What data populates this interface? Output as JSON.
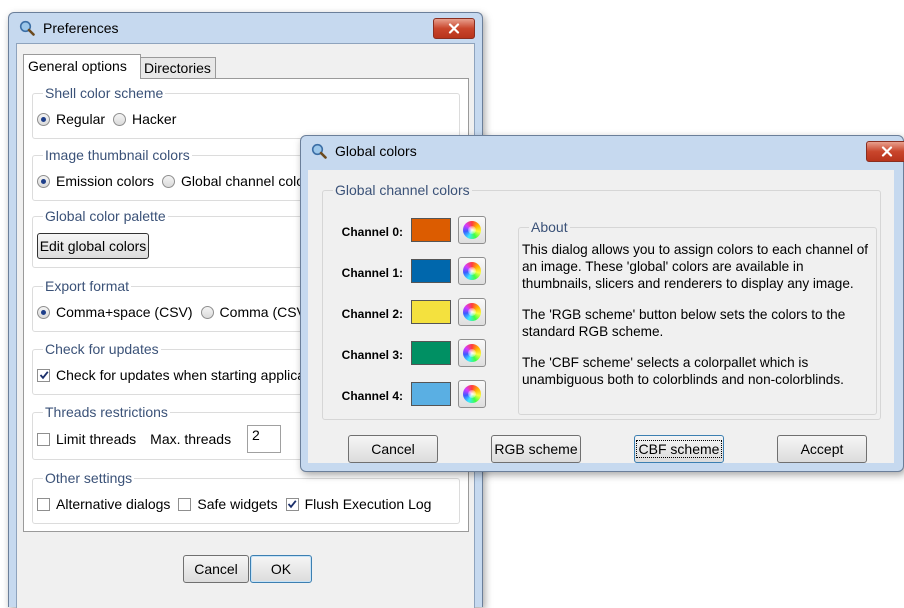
{
  "preferences": {
    "title": "Preferences",
    "tabs": [
      "General options",
      "Directories"
    ],
    "shell": {
      "label": "Shell color scheme",
      "options": [
        "Regular",
        "Hacker"
      ]
    },
    "thumbnail": {
      "label": "Image thumbnail colors",
      "options": [
        "Emission colors",
        "Global channel colors"
      ]
    },
    "palette": {
      "label": "Global color palette",
      "button": "Edit global colors"
    },
    "export": {
      "label": "Export format",
      "options": [
        "Comma+space (CSV)",
        "Comma (CSV)"
      ]
    },
    "updates": {
      "label": "Check for updates",
      "checkbox": "Check for updates when starting application"
    },
    "threads": {
      "label": "Threads restrictions",
      "limit": "Limit threads",
      "max_label": "Max. threads",
      "max_value": "2"
    },
    "other": {
      "label": "Other settings",
      "options": [
        "Alternative dialogs",
        "Safe widgets",
        "Flush Execution Log"
      ]
    },
    "cancel": "Cancel",
    "ok": "OK"
  },
  "global_colors": {
    "title": "Global colors",
    "group_label": "Global channel colors",
    "channels": [
      {
        "label": "Channel 0:",
        "color": "#dc5c00"
      },
      {
        "label": "Channel 1:",
        "color": "#0067ac"
      },
      {
        "label": "Channel 2:",
        "color": "#f4e13e"
      },
      {
        "label": "Channel 3:",
        "color": "#009063"
      },
      {
        "label": "Channel 4:",
        "color": "#5aafe3"
      }
    ],
    "about_label": "About",
    "about_paragraphs": [
      "This dialog allows you to assign colors to each channel of an image. These 'global' colors are available in thumbnails, slicers and renderers to display any image.",
      "The 'RGB scheme' button below sets the colors to the standard RGB scheme.",
      "The 'CBF scheme' selects a colorpallet which is unambiguous both to colorblinds and non-colorblinds."
    ],
    "buttons": [
      "Cancel",
      "RGB scheme",
      "CBF scheme",
      "Accept"
    ]
  },
  "icons": {
    "app": "magnifier-icon",
    "close": "close-icon",
    "color_picker": "color-wheel-icon"
  }
}
